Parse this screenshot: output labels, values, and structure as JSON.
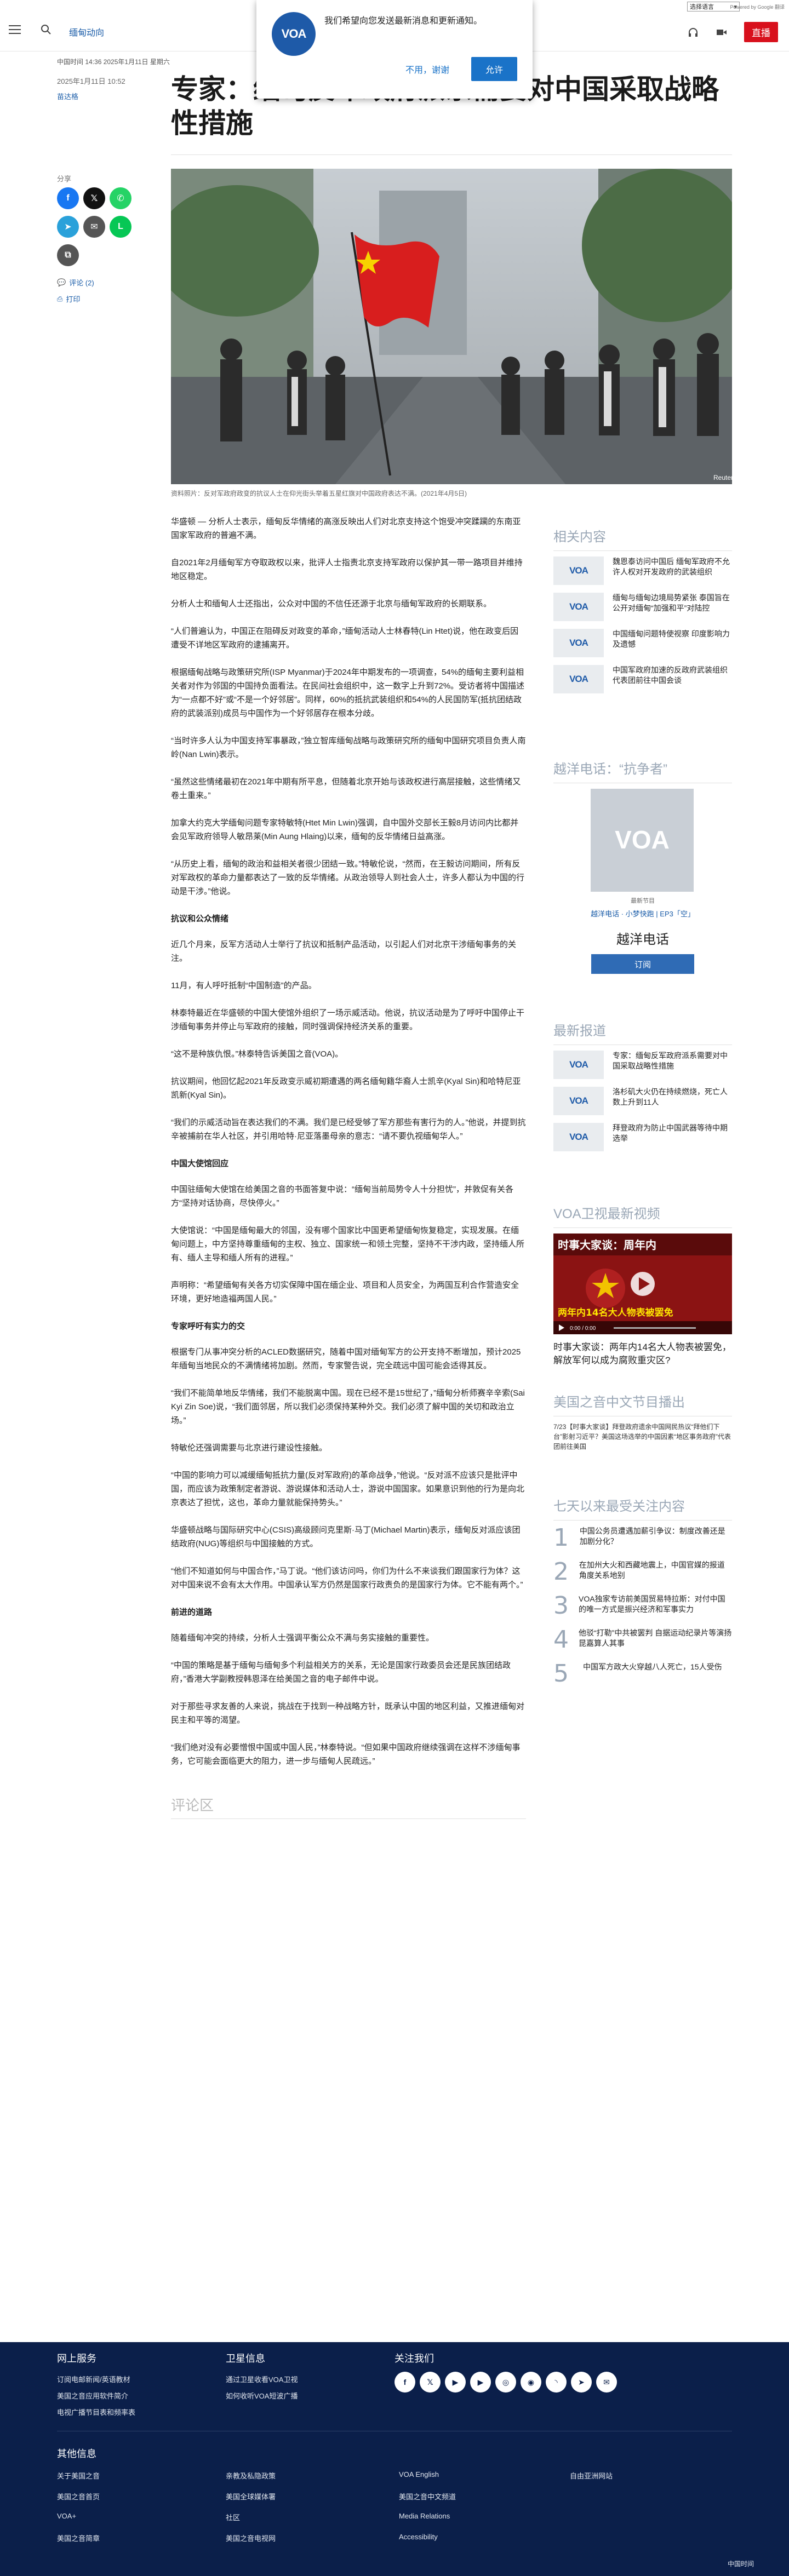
{
  "utility": {
    "language_select": "选择语言",
    "powered_by": "Powered by Google 翻译"
  },
  "header": {
    "section": "缅甸动向",
    "live": "直播"
  },
  "notification": {
    "message": "我们希望向您发送最新消息和更新通知。",
    "deny": "不用，谢谢",
    "allow": "允许",
    "logo": "VOA"
  },
  "article": {
    "meta_top": "中国时间 14:36 2025年1月11日 星期六",
    "date": "2025年1月11日 10:52",
    "author": "苗达格",
    "title": "专家：缅甸反军政府派系需要对中国采取战略性措施",
    "share_label": "分享",
    "comments_link": "评论 (2)",
    "print_link": "打印",
    "caption": "资料照片：反对军政府政变的抗议人士在仰光街头举着五星红旗对中国政府表达不满。(2021年4月5日)",
    "photo_credit": "Reuters",
    "paragraphs": [
      "华盛顿 — 分析人士表示，缅甸反华情绪的高涨反映出人们对北京支持这个饱受冲突蹂躏的东南亚国家军政府的普遍不满。",
      "自2021年2月缅甸军方夺取政权以来，批评人士指责北京支持军政府以保护其一带一路项目并维持地区稳定。",
      "分析人士和缅甸人士还指出，公众对中国的不信任还源于北京与缅甸军政府的长期联系。",
      "“人们普遍认为，中国正在阻碍反对政变的革命，”缅甸活动人士林春特(Lin Htet)说，他在政变后因遭受不详地区军政府的逮捕离开。",
      "根据缅甸战略与政策研究所(ISP Myanmar)于2024年中期发布的一项调查，54%的缅甸主要利益相关者对作为邻国的中国持负面看法。在民间社会组织中，这一数字上升到72%。受访者将中国描述为“一点都不好”或“不是一个好邻居”。同样，60%的抵抗武装组织和54%的人民国防军(抵抗团结政府的武装派别)成员与中国作为一个好邻居存在根本分歧。",
      "“当时许多人认为中国支持军事暴政，”独立智库缅甸战略与政策研究所的缅甸中国研究项目负责人南岭(Nan Lwin)表示。",
      "“虽然这些情绪最初在2021年中期有所平息，但随着北京开始与该政权进行高层接触，这些情绪又卷土重来。”",
      "加拿大约克大学缅甸问题专家特敏特(Htet Min Lwin)强调，自中国外交部长王毅8月访问内比都并会见军政府领导人敏昂莱(Min Aung Hlaing)以来，缅甸的反华情绪日益高涨。",
      "“从历史上看，缅甸的政治和益相关者很少团结一致。”特敏伦说，“然而，在王毅访问期间，所有反对军政权的革命力量都表达了一致的反华情绪。从政治领导人到社会人士，许多人都认为中国的行动是干涉。”他说。"
    ],
    "h_protest": "抗议和公众情绪",
    "paragraphs_2": [
      "近几个月来，反军方活动人士举行了抗议和抵制产品活动，以引起人们对北京干涉缅甸事务的关注。",
      "11月，有人呼吁抵制“中国制造”的产品。",
      "林泰特最近在华盛顿的中国大使馆外组织了一场示威活动。他说，抗议活动是为了呼吁中国停止干涉缅甸事务并停止与军政府的接触，同时强调保持经济关系的重要。",
      "“这不是种族仇恨。”林泰特告诉美国之音(VOA)。",
      "抗议期间，他回忆起2021年反政变示威初期遭遇的两名缅甸籍华裔人士凯辛(Kyal Sin)和哈特尼亚凯新(Kyal Sin)。",
      "“我们的示威活动旨在表达我们的不满。我们是已经受够了军方那些有害行为的人。”他说，并提到抗辛被捕前在华人社区，并引用哈特·尼亚落墨母亲的意志：“请不要仇视缅甸华人。”"
    ],
    "h_embassy": "中国大使馆回应",
    "paragraphs_3": [
      "中国驻缅甸大使馆在给美国之音的书面答复中说：“缅甸当前局势令人十分担忧”，并敦促有关各方“坚持对话协商，尽快停火。”",
      "大使馆说：“中国是缅甸最大的邻国，没有哪个国家比中国更希望缅甸恢复稳定，实现发展。在缅甸问题上，中方坚持尊重缅甸的主权、独立、国家统一和领土完整，坚持不干涉内政，坚持缅人所有、缅人主导和缅人所有的进程。”",
      "声明称：“希望缅甸有关各方切实保障中国在缅企业、项目和人员安全，为两国互利合作营造安全环境，更好地造福两国人民。”"
    ],
    "h_engagement": "专家呼吁有实力的交",
    "paragraphs_4": [
      "根据专门从事冲突分析的ACLED数据研究，随着中国对缅甸军方的公开支持不断增加，预计2025年缅甸当地民众的不满情绪将加剧。然而，专家警告说，完全疏远中国可能会适得其反。",
      "“我们不能简单地反华情绪，我们不能脱离中国。现在已经不是15世纪了，”缅甸分析师赛辛辛索(Sai Kyi Zin Soe)说，“我们面邻居，所以我们必须保持某种外交。我们必须了解中国的关切和政治立场。”",
      "特敏伦还强调需要与北京进行建设性接触。",
      "“中国的影响力可以减缓缅甸抵抗力量(反对军政府)的革命战争，”他说。“反对派不应该只是批评中国，而应该为政策制定者游说、游说媒体和活动人士，游说中国国家。如果意识到他的行为是向北京表达了担忧，这也，革命力量就能保持势头。”",
      "华盛顿战略与国际研究中心(CSIS)高级顾问克里斯·马丁(Michael Martin)表示，缅甸反对派应该团结政府(NUG)等组织与中国接触的方式。",
      "“他们不知道如何与中国合作，”马丁说。“他们该访问吗，你们为什么不来谈我们跟国家行为体？这对中国来说不会有太大作用。中国承认军方仍然是国家行政责负的是国家行为体。它不能有两个。”"
    ],
    "h_road": "前进的道路",
    "paragraphs_5": [
      "随着缅甸冲突的持续，分析人士强调平衡公众不满与务实接触的重要性。",
      "“中国的策略是基于缅甸与缅甸多个利益相关方的关系，无论是国家行政委员会还是民族团结政府，”香港大学副教授韩恩泽在给美国之音的电子邮件中说。",
      "对于那些寻求友善的人来说，挑战在于找到一种战略方针，既承认中国的地区利益，又推进缅甸对民主和平等的渴望。",
      "“我们绝对没有必要憎恨中国或中国人民，”林泰特说。“但如果中国政府继续强调在这样不涉缅甸事务，它可能会面临更大的阻力，进一步与缅甸人民疏远。”"
    ],
    "comments_heading": "评论区"
  },
  "sidebar": {
    "related_title": "相关内容",
    "related": [
      "魏恩泰访问中国后 缅甸军政府不允许人权对开发政府的武装组织",
      "缅甸与缅甸边境局势紧张 泰国旨在公开对缅甸“加强和平”对陆控",
      "中国缅甸问题特使视察 印度影响力及遗憾",
      "中国军政府加速的反政府武装组织代表团前往中国会谈"
    ],
    "podcast_title": "越洋电话：“抗争者”",
    "podcast_meta": "最新节目",
    "podcast_sub": "越洋电话 · 小梦快跑 | EP3「空」",
    "podcast_name": "越洋电话",
    "subscribe": "订阅",
    "latest_title": "最新报道",
    "latest": [
      "专家：缅甸反军政府派系需要对中国采取战略性措施",
      "洛杉矶大火仍在持续燃烧，死亡人数上升到11人",
      "拜登政府为防止中国武器等待中期选举"
    ],
    "video_title": "VOA卫视最新视频",
    "video_overlay_top": "时事大家谈：周年内",
    "video_overlay_mid": "两年内14名大人物表被罢免",
    "video_time": "0:00 / 0:00",
    "video_caption": "时事大家谈：两年内14名大人物表被罢免，解放军何以成为腐败重灾区?",
    "schedule_title": "美国之音中文节目播出",
    "schedule_text": "7/23【时事大家谈】拜登政府遗余中国网民热议“拜他们下台”影射习近平？美国这场选举的中国因素“地区事务政府”代表团前往美国",
    "popular_title": "七天以来最受关注内容",
    "popular": [
      "中国公务员遭遇加薪引争议：制度改善还是加剧分化？",
      "在加州大火和西藏地震上，中国官媒的报道角度关系地别",
      "VOA独家专访前美国贸易特拉斯：对付中国的唯一方式是振兴经济和军事实力",
      "他驳“打勒”中共被罢判 自据运动纪录片等演扬昆嘉算人其事",
      "中国军方政大火穿越八人死亡，15人受伤"
    ]
  },
  "footer": {
    "online_title": "网上服务",
    "online": [
      "订阅电邮新闻/英语教材",
      "美国之音应用软件简介",
      "电视广播节目表和频率表"
    ],
    "sat_title": "卫星信息",
    "sat": [
      "通过卫星收看VOA卫视",
      "如何收听VOA短波广播"
    ],
    "follow_title": "关注我们",
    "other_title": "其他信息",
    "other": [
      [
        "关于美国之音",
        "美国之音首页",
        "VOA+",
        "美国之音简章"
      ],
      [
        "亲教及私隐政策",
        "美国全球媒体署",
        "社区",
        "美国之音电视网"
      ],
      [
        "VOA English",
        "美国之音中文频道",
        "Media Relations",
        "Accessibility"
      ],
      [
        "自由亚洲网站"
      ]
    ],
    "copyright": "中国时间"
  }
}
